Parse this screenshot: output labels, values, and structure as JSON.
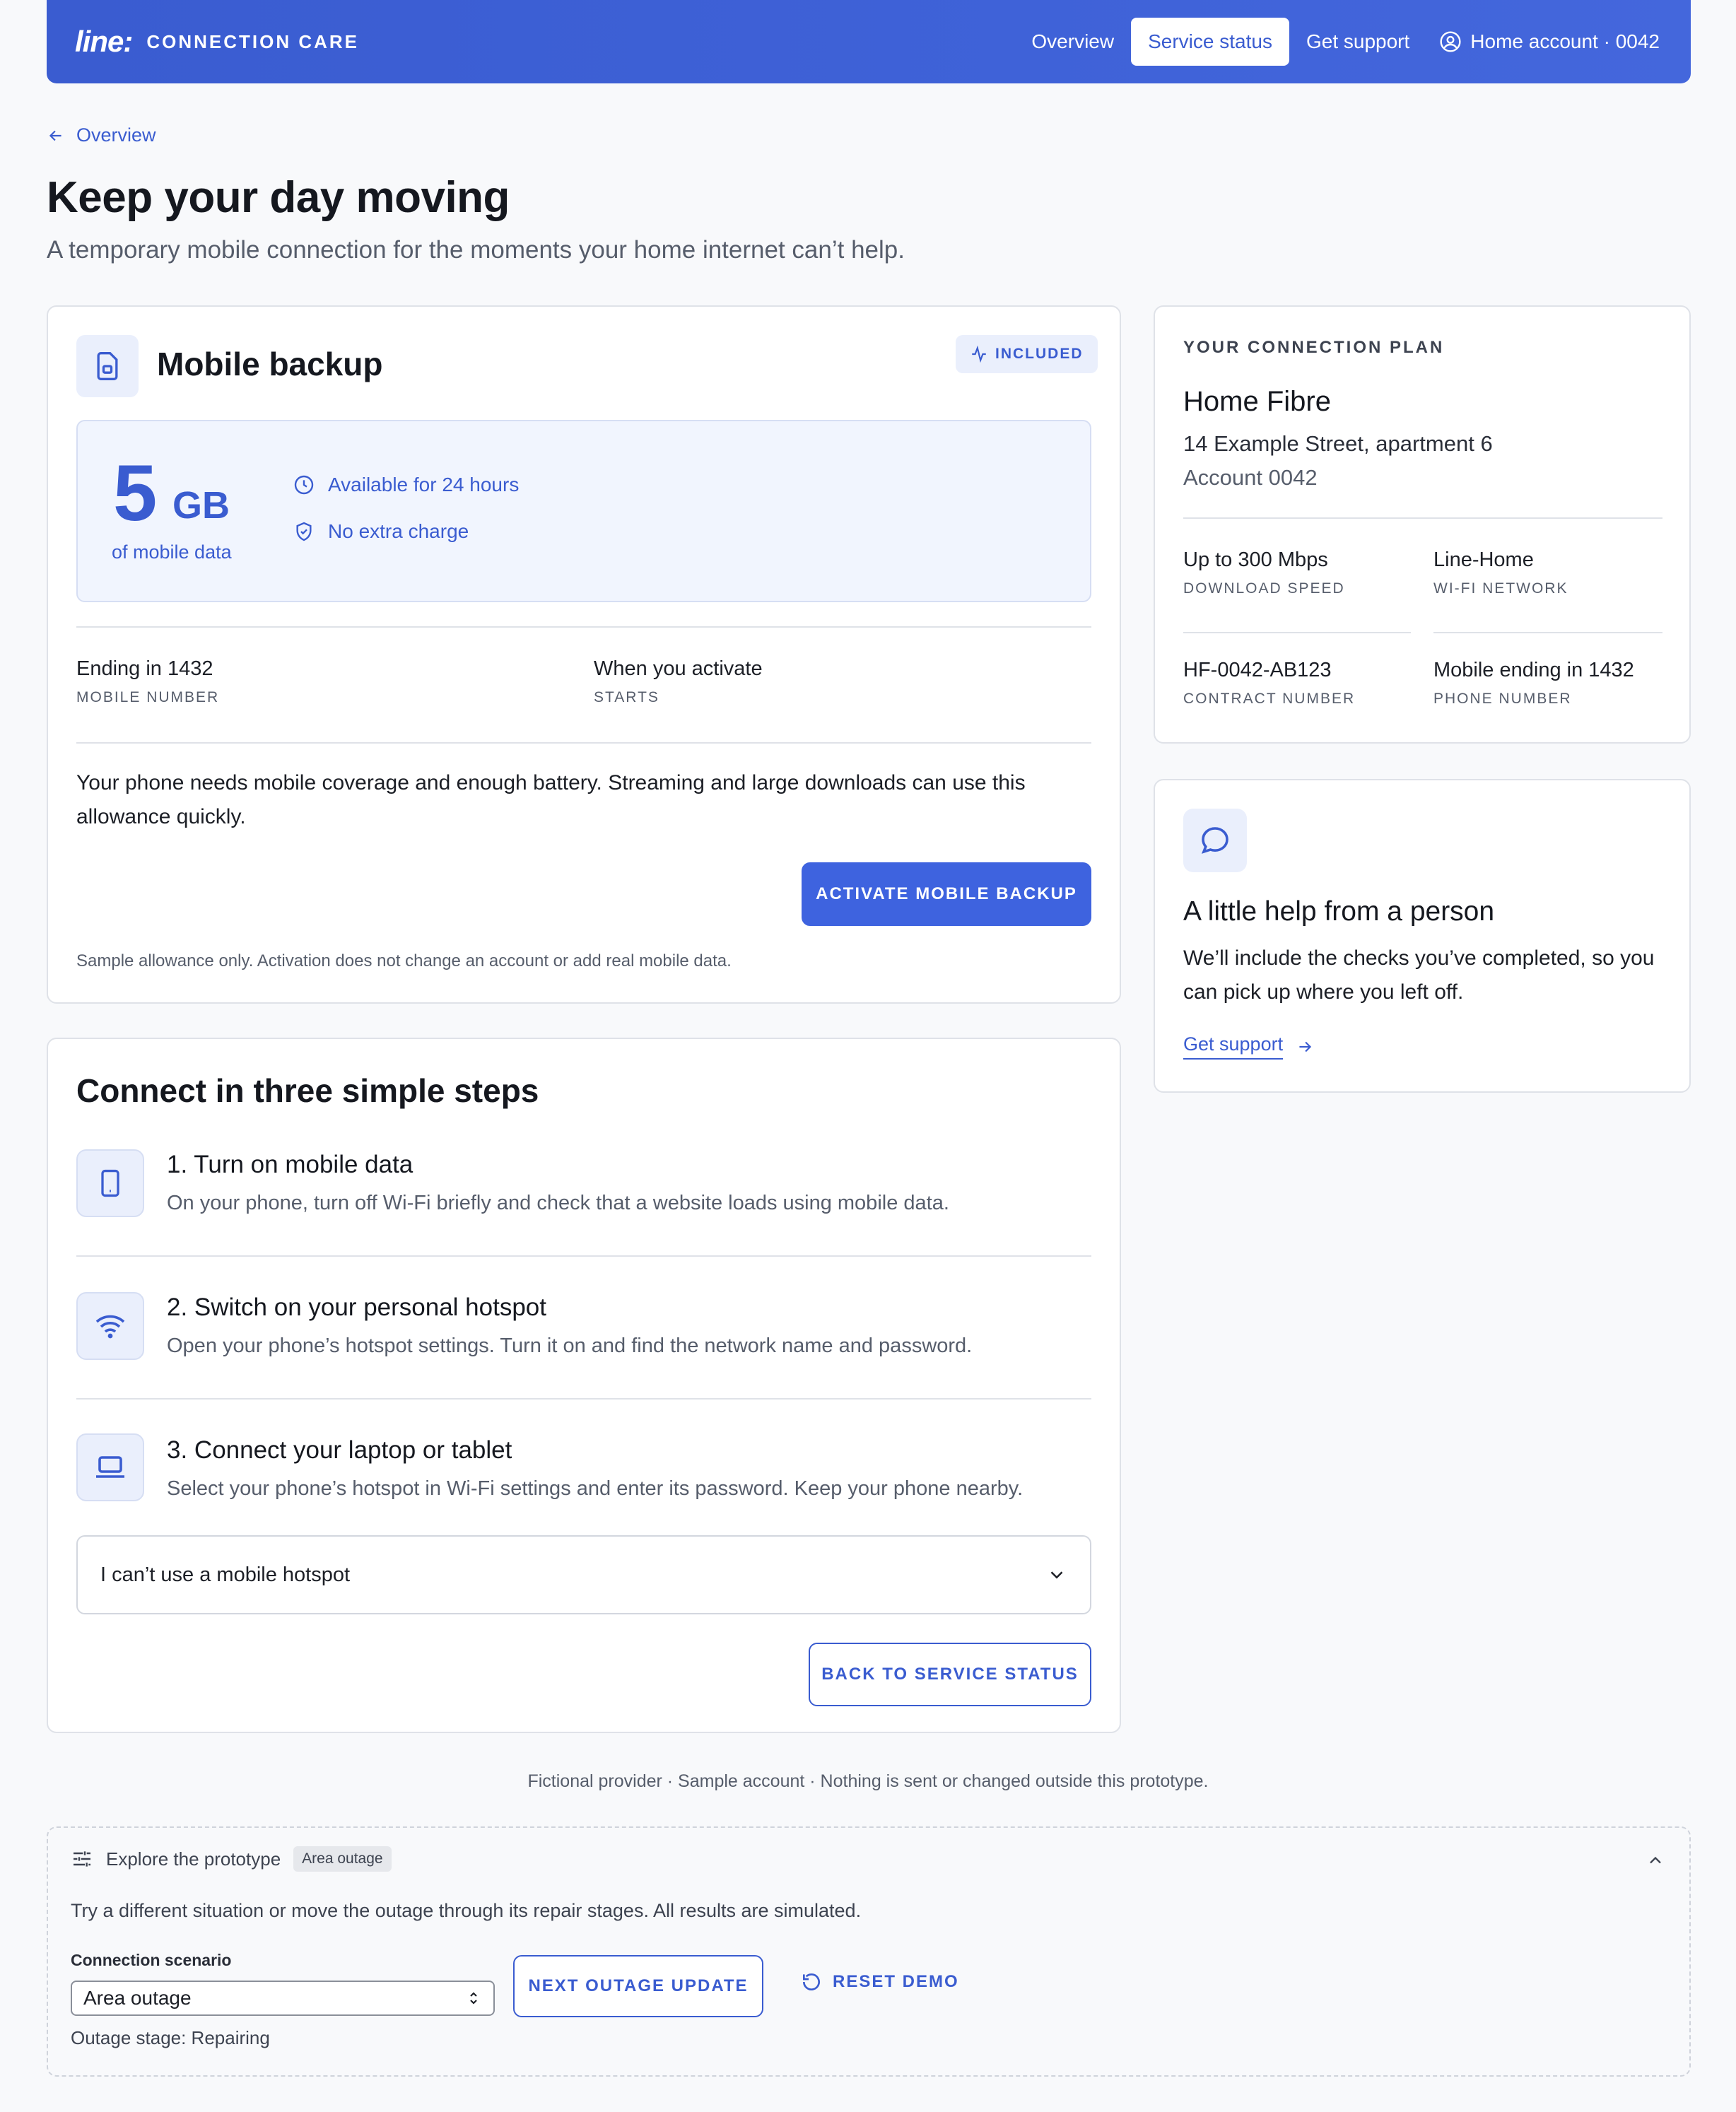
{
  "header": {
    "logo": "line:",
    "brand_sub": "CONNECTION CARE",
    "nav": {
      "overview": "Overview",
      "service_status": "Service status",
      "get_support": "Get support",
      "account": "Home account · 0042"
    }
  },
  "backlink": "Overview",
  "page": {
    "title": "Keep your day moving",
    "subtitle": "A temporary mobile connection for the moments your home internet can’t help."
  },
  "mobile_backup": {
    "title": "Mobile backup",
    "badge": "INCLUDED",
    "amount": "5",
    "unit": "GB",
    "amount_sub": "of mobile data",
    "features": [
      "Available for 24 hours",
      "No extra charge"
    ],
    "facts": [
      {
        "value": "Ending in 1432",
        "label": "MOBILE NUMBER"
      },
      {
        "value": "When you activate",
        "label": "STARTS"
      }
    ],
    "note": "Your phone needs mobile coverage and enough battery. Streaming and large downloads can use this allowance quickly.",
    "activate_label": "ACTIVATE MOBILE BACKUP",
    "fine_print": "Sample allowance only. Activation does not change an account or add real mobile data."
  },
  "steps": {
    "title": "Connect in three simple steps",
    "items": [
      {
        "title": "1. Turn on mobile data",
        "desc": "On your phone, turn off Wi-Fi briefly and check that a website loads using mobile data."
      },
      {
        "title": "2. Switch on your personal hotspot",
        "desc": "Open your phone’s hotspot settings. Turn it on and find the network name and password."
      },
      {
        "title": "3. Connect your laptop or tablet",
        "desc": "Select your phone’s hotspot in Wi-Fi settings and enter its password. Keep your phone nearby."
      }
    ],
    "dropdown_label": "I can’t use a mobile hotspot",
    "back_label": "BACK TO SERVICE STATUS"
  },
  "plan": {
    "eyebrow": "YOUR CONNECTION PLAN",
    "name": "Home Fibre",
    "address": "14 Example Street, apartment 6",
    "account": "Account 0042",
    "facts": [
      {
        "value": "Up to 300 Mbps",
        "label": "DOWNLOAD SPEED"
      },
      {
        "value": "Line-Home",
        "label": "WI-FI NETWORK"
      },
      {
        "value": "HF-0042-AB123",
        "label": "CONTRACT NUMBER"
      },
      {
        "value": "Mobile ending in 1432",
        "label": "PHONE NUMBER"
      }
    ]
  },
  "help": {
    "title": "A little help from a person",
    "desc": "We’ll include the checks you’ve completed, so you can pick up where you left off.",
    "link": "Get support"
  },
  "footer_note": "Fictional provider · Sample account · Nothing is sent or changed outside this prototype.",
  "prototype": {
    "heading": "Explore the prototype",
    "tag": "Area outage",
    "desc": "Try a different situation or move the outage through its repair stages. All results are simulated.",
    "scenario_label": "Connection scenario",
    "scenario_value": "Area outage",
    "next_label": "NEXT OUTAGE UPDATE",
    "reset_label": "RESET DEMO",
    "stage": "Outage stage: Repairing"
  },
  "colors": {
    "accent": "#3a5cd0",
    "accent_light": "#eaeffc",
    "background": "#f8f9fb",
    "border": "#dfe2e8"
  },
  "icons": {
    "sim": "sim-card-icon",
    "activity": "activity-icon",
    "clock": "clock-icon",
    "shield": "shield-check-icon",
    "phone": "phone-icon",
    "wifi": "wifi-icon",
    "laptop": "laptop-icon",
    "chat": "chat-bubble-icon"
  }
}
